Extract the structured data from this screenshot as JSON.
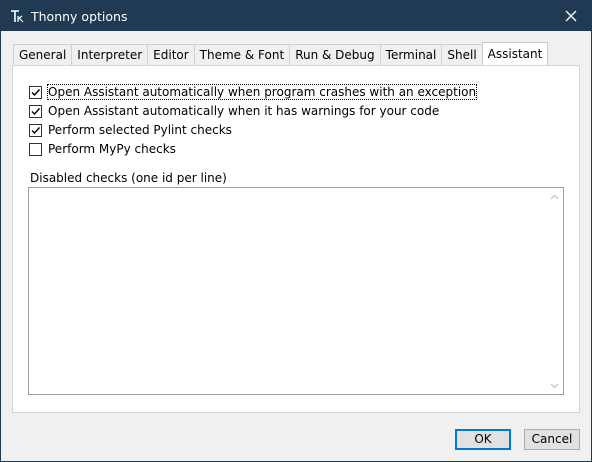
{
  "window": {
    "title": "Thonny options"
  },
  "tabs": [
    {
      "label": "General"
    },
    {
      "label": "Interpreter"
    },
    {
      "label": "Editor"
    },
    {
      "label": "Theme & Font"
    },
    {
      "label": "Run & Debug"
    },
    {
      "label": "Terminal"
    },
    {
      "label": "Shell"
    },
    {
      "label": "Assistant",
      "active": true
    }
  ],
  "assistant": {
    "options": [
      {
        "label": "Open Assistant automatically when program crashes with an exception",
        "checked": true
      },
      {
        "label": "Open Assistant automatically when it has warnings for your code",
        "checked": true
      },
      {
        "label": "Perform selected Pylint checks",
        "checked": true
      },
      {
        "label": "Perform MyPy checks",
        "checked": false
      }
    ],
    "disabled_checks_label": "Disabled checks (one id per line)",
    "disabled_checks_value": ""
  },
  "buttons": {
    "ok": "OK",
    "cancel": "Cancel"
  },
  "colors": {
    "titlebar": "#1f3a52",
    "accent": "#0078d7"
  }
}
